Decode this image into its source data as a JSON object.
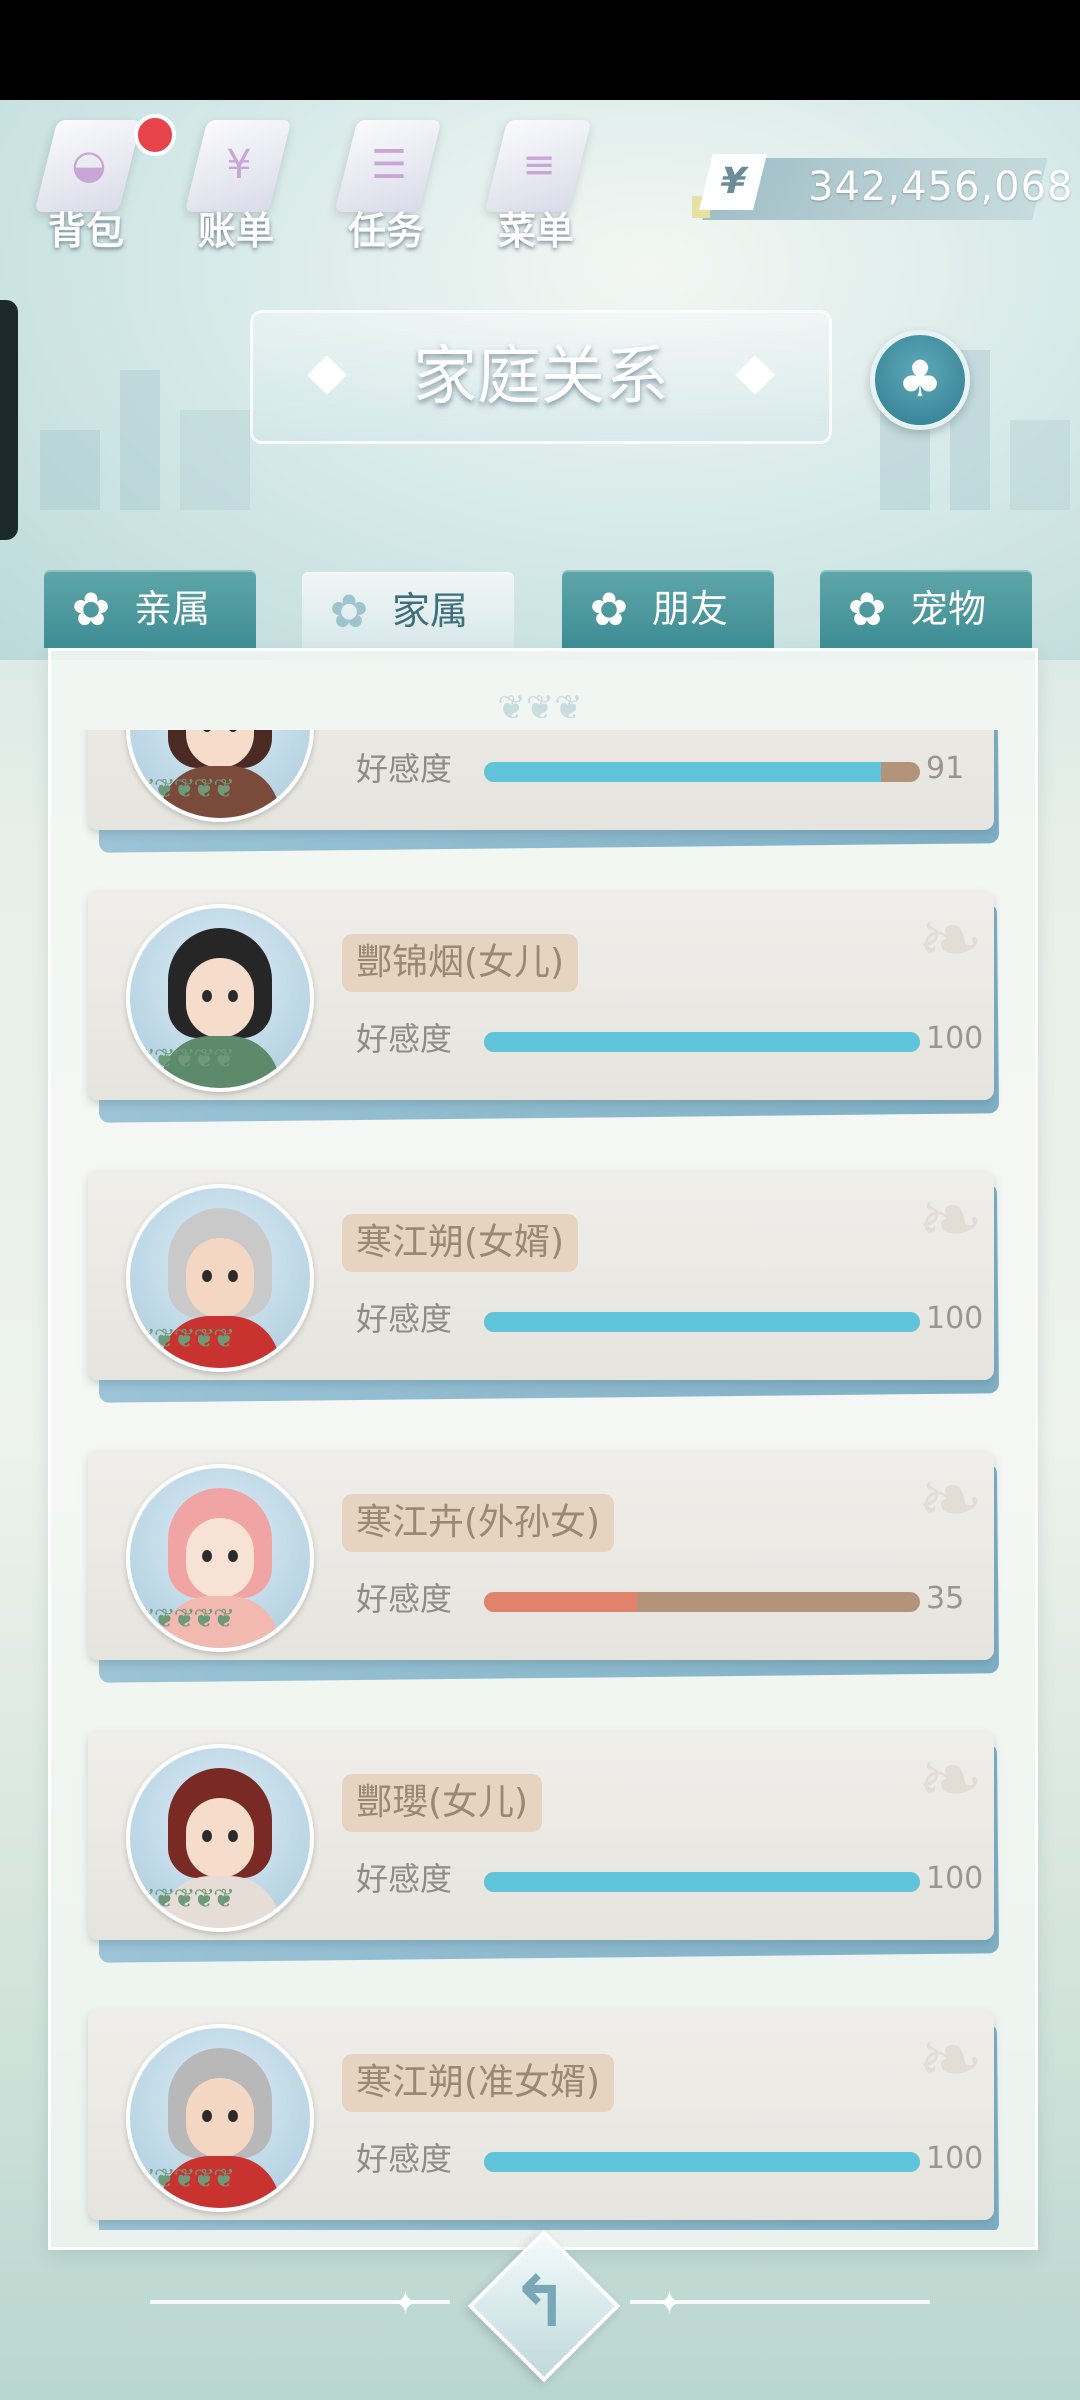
{
  "toolbar": {
    "items": [
      {
        "label": "背包",
        "icon": "backpack-icon"
      },
      {
        "label": "账单",
        "icon": "bill-icon"
      },
      {
        "label": "任务",
        "icon": "task-icon"
      },
      {
        "label": "菜单",
        "icon": "menu-icon"
      }
    ],
    "currency_symbol": "¥",
    "money": "342,456,068"
  },
  "header": {
    "title": "家庭关系"
  },
  "tabs": [
    {
      "label": "亲属",
      "active": false
    },
    {
      "label": "家属",
      "active": true
    },
    {
      "label": "朋友",
      "active": false
    },
    {
      "label": "宠物",
      "active": false
    }
  ],
  "affinity_label": "好感度",
  "members": [
    {
      "name": "",
      "affinity": 91,
      "affinity_text": "91",
      "avatar": {
        "hair": "#4a2a22",
        "body": "#7a4a3a",
        "skin": "#f6dccb"
      }
    },
    {
      "name": "酆锦烟(女儿)",
      "affinity": 100,
      "affinity_text": "100",
      "avatar": {
        "hair": "#262626",
        "body": "#5c8a6a",
        "skin": "#f6dccb"
      }
    },
    {
      "name": "寒江朔(女婿)",
      "affinity": 100,
      "affinity_text": "100",
      "avatar": {
        "hair": "#c9c9c9",
        "body": "#c8322f",
        "skin": "#f3d7c3"
      }
    },
    {
      "name": "寒江卉(外孙女)",
      "affinity": 35,
      "affinity_text": "35",
      "avatar": {
        "hair": "#f0a4a4",
        "body": "#f2b9b0",
        "skin": "#f8e2d6"
      }
    },
    {
      "name": "酆瓔(女儿)",
      "affinity": 100,
      "affinity_text": "100",
      "avatar": {
        "hair": "#7a2a24",
        "body": "#e6ddd6",
        "skin": "#f6dccb"
      }
    },
    {
      "name": "寒江朔(准女婿)",
      "affinity": 100,
      "affinity_text": "100",
      "avatar": {
        "hair": "#b8b8b8",
        "body": "#c8322f",
        "skin": "#f3d7c3"
      }
    }
  ],
  "colors": {
    "accent": "#5fc4da",
    "low": "#e0836a",
    "tab": "#3d8d93"
  },
  "back_button_icon": "return-icon"
}
